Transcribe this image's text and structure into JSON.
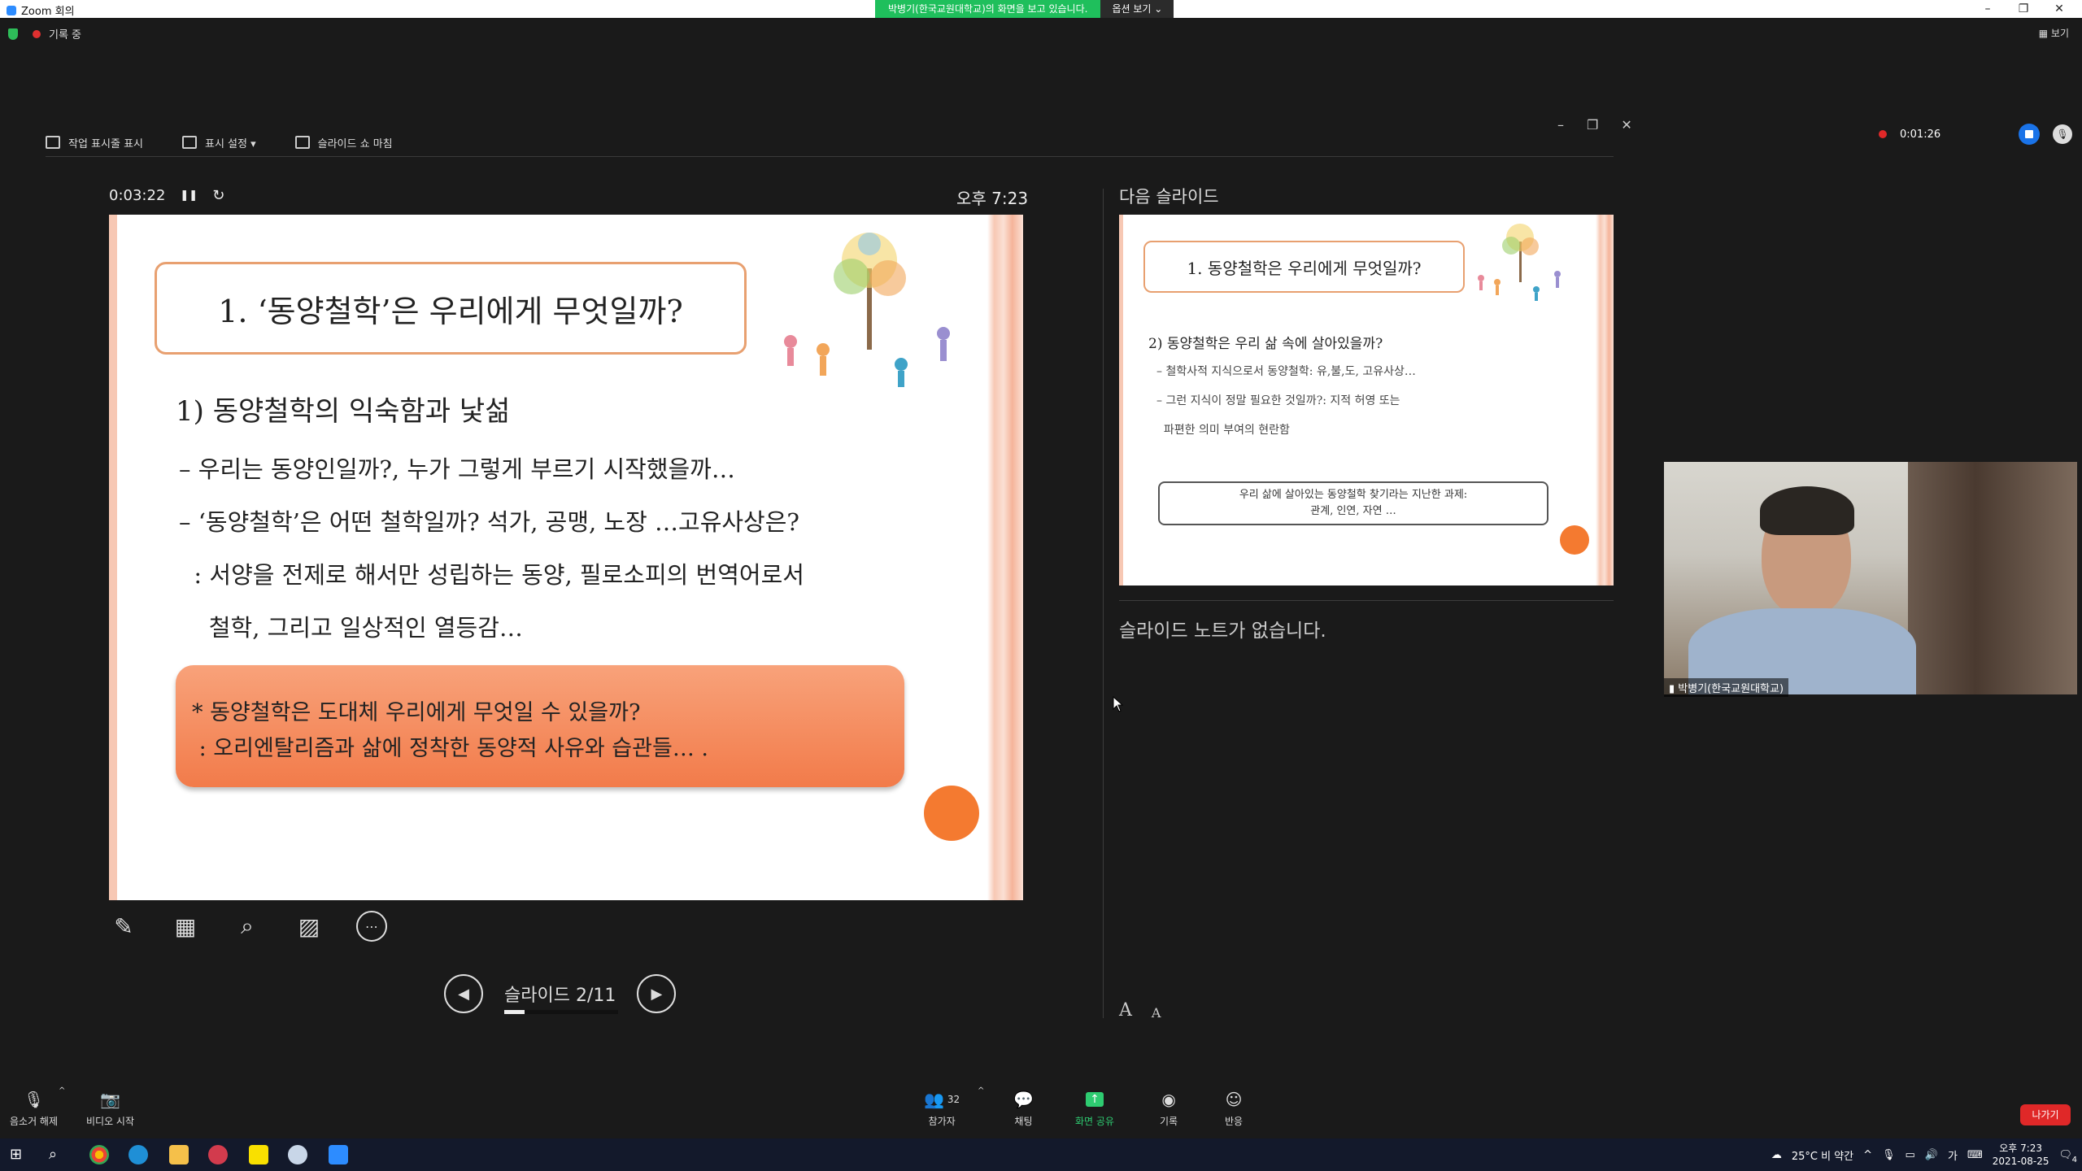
{
  "window": {
    "title": "Zoom 회의",
    "minimize": "–",
    "maximize": "❐",
    "close": "✕"
  },
  "share_banner": {
    "message": "박병기(한국교원대학교)의 화면을 보고 있습니다.",
    "options": "옵션 보기 ⌄"
  },
  "recording_status": {
    "label": "기록 중"
  },
  "view_button": {
    "label": "보기"
  },
  "presenter_toolbar": {
    "taskbar_label": "작업 표시줄 표시",
    "display_settings_label": "표시 설정 ▾",
    "end_show_label": "슬라이드 쇼 마침"
  },
  "timer": {
    "elapsed": "0:03:22",
    "pause_icon": "❚❚",
    "reset_icon": "↻"
  },
  "clock": {
    "time": "오후 7:23"
  },
  "slide": {
    "title": "1. ‘동양철학’은 우리에게 무엇일까?",
    "heading": "1) 동양철학의 익숙함과 낯섦",
    "lines": [
      "– 우리는 동양인일까?, 누가 그렇게 부르기 시작했을까…",
      "– ‘동양철학’은 어떤 철학일까? 석가, 공맹, 노장 …고유사상은?",
      "  : 서양을 전제로 해서만 성립하는 동양, 필로소피의 번역어로서",
      "    철학, 그리고 일상적인 열등감…"
    ],
    "callout": [
      "* 동양철학은 도대체 우리에게 무엇일 수 있을까?",
      " : 오리엔탈리즘과 삶에 정착한 동양적 사유와 습관들… ."
    ]
  },
  "navigation": {
    "counter": "슬라이드 2/11",
    "progress": 0.18,
    "prev_icon": "◀",
    "next_icon": "▶"
  },
  "next_slide": {
    "label": "다음 슬라이드",
    "title": "1. 동양철학은 우리에게 무엇일까?",
    "heading": "2) 동양철학은 우리 삶 속에 살아있을까?",
    "lines": [
      "– 철학사적 지식으로서 동양철학: 유,불,도, 고유사상…",
      "– 그런 지식이 정말 필요한 것일까?: 지적 허영 또는",
      "  파편한 의미 부여의 현란함"
    ],
    "box_lines": [
      "우리 삶에 살아있는 동양철학 찾기라는 지난한 과제:",
      "관계, 인연, 자연 …"
    ]
  },
  "notes": {
    "empty_text": "슬라이드 노트가 없습니다."
  },
  "font_buttons": {
    "increase": "A",
    "decrease": "A"
  },
  "rec_widget": {
    "time": "0:01:26"
  },
  "video": {
    "name": "박병기(한국교원대학교)"
  },
  "bottom_toolbar": {
    "unmute": "음소거 해제",
    "start_video": "비디오 시작",
    "participants": "참가자",
    "participant_count": "32",
    "chat": "채팅",
    "share_screen": "화면 공유",
    "record": "기록",
    "reactions": "반응",
    "leave": "나가기"
  },
  "taskbar": {
    "weather": "25°C 비 약간",
    "ime": "가",
    "time": "오후 7:23",
    "date": "2021-08-25",
    "notifications": "4"
  },
  "colors": {
    "accent_orange": "#f47a30",
    "title_border": "#e8a070",
    "share_green": "#1fbf5c",
    "leave_red": "#e02828",
    "stop_blue": "#1a73e8"
  }
}
